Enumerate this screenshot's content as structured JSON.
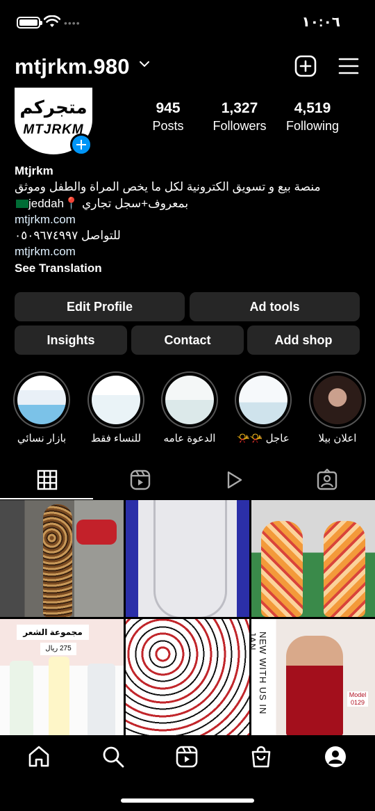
{
  "status_bar": {
    "time": "١٠:٠٦",
    "signal_dots": "••••"
  },
  "header": {
    "username": "mtjrkm.980"
  },
  "profile": {
    "avatar_text_ar": "متجركم",
    "avatar_text_en": "MTJRKM",
    "stats": {
      "posts": {
        "count": "945",
        "label": "Posts"
      },
      "followers": {
        "count": "1,327",
        "label": "Followers"
      },
      "following": {
        "count": "4,519",
        "label": "Following"
      }
    },
    "bio": {
      "name": "Mtjrkm",
      "line1": "منصة بيع و تسويق الكترونية لكل ما يخص المراة والطفل وموثق",
      "line2": "بمعروف+سجل تجاري 📍jeddah",
      "link1": "mtjrkm.com",
      "contact": "للتواصل ٠٥٠٩٦٧٤٩٩٧",
      "link2": "mtjrkm.com",
      "see_translation": "See Translation"
    }
  },
  "buttons": {
    "edit_profile": "Edit Profile",
    "ad_tools": "Ad tools",
    "insights": "Insights",
    "contact": "Contact",
    "add_shop": "Add shop"
  },
  "highlights": [
    {
      "label": "بازار نسائي"
    },
    {
      "label": "للنساء فقط"
    },
    {
      "label": "الدعوة عامه"
    },
    {
      "label": "عاجل 📯📯"
    },
    {
      "label": "اعلان بيلا"
    }
  ],
  "posts": {
    "p4_tag": "مجموعة الشعر",
    "p4_price": "275 ريال",
    "p6_vertical": "NEW WITH US IN JAN",
    "p6_model": "Model 0129"
  },
  "colors": {
    "accent": "#0095f6",
    "button_bg": "#262626",
    "background": "#000000"
  }
}
